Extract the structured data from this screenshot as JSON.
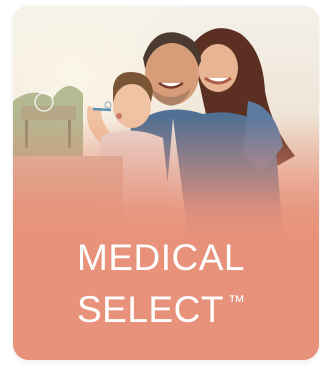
{
  "card": {
    "title_line1": "MEDICAL",
    "title_line2": "SELECT",
    "trademark": "™",
    "accent_color": "#e8927b"
  }
}
